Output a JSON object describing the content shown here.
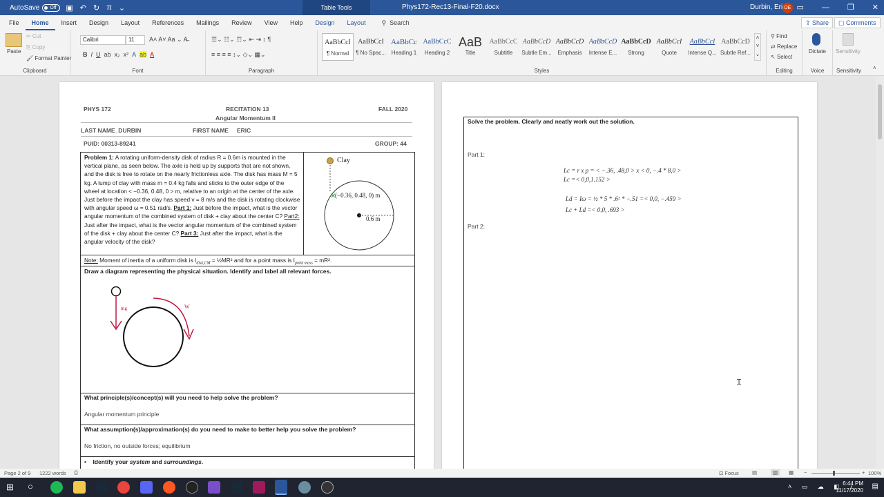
{
  "titlebar": {
    "autosave_label": "AutoSave",
    "autosave_state": "Off",
    "context_tab": "Table Tools",
    "doc_title": "Phys172-Rec13-Final-F20.docx",
    "user": "Durbin, Eric",
    "initials": "DE"
  },
  "menu": {
    "items": [
      "File",
      "Home",
      "Insert",
      "Design",
      "Layout",
      "References",
      "Mailings",
      "Review",
      "View",
      "Help",
      "Design",
      "Layout"
    ],
    "search": "Search",
    "share": "Share",
    "comments": "Comments"
  },
  "ribbon": {
    "clipboard": {
      "paste": "Paste",
      "cut": "Cut",
      "copy": "Copy",
      "format_painter": "Format Painter",
      "label": "Clipboard"
    },
    "font": {
      "family": "Calibri",
      "size": "11",
      "label": "Font"
    },
    "paragraph": {
      "label": "Paragraph"
    },
    "styles": {
      "items": [
        {
          "preview": "AaBbCcI",
          "name": "¶ Normal"
        },
        {
          "preview": "AaBbCcI",
          "name": "¶ No Spac..."
        },
        {
          "preview": "AaBbCc",
          "name": "Heading 1"
        },
        {
          "preview": "AaBbCcC",
          "name": "Heading 2"
        },
        {
          "preview": "AaB",
          "name": "Title"
        },
        {
          "preview": "AaBbCcC",
          "name": "Subtitle"
        },
        {
          "preview": "AaBbCcD",
          "name": "Subtle Em..."
        },
        {
          "preview": "AaBbCcD",
          "name": "Emphasis"
        },
        {
          "preview": "AaBbCcD",
          "name": "Intense E..."
        },
        {
          "preview": "AaBbCcD",
          "name": "Strong"
        },
        {
          "preview": "AaBbCcI",
          "name": "Quote"
        },
        {
          "preview": "AaBbCcI",
          "name": "Intense Q..."
        },
        {
          "preview": "AaBbCcD",
          "name": "Subtle Ref..."
        }
      ],
      "label": "Styles"
    },
    "editing": {
      "find": "Find",
      "replace": "Replace",
      "select": "Select",
      "label": "Editing"
    },
    "voice": {
      "dictate": "Dictate",
      "label": "Voice"
    },
    "sensitivity": {
      "btn": "Sensitivity",
      "label": "Sensitivity"
    }
  },
  "page1": {
    "course": "PHYS 172",
    "recitation": "RECITATION 13",
    "topic": "Angular Momentum II",
    "term": "FALL 2020",
    "last_name_label": "LAST NAME_DURBIN",
    "first_name_label": "FIRST NAME",
    "first_name": "ERIC",
    "puid": "PUID: 00313-89241",
    "group": "GROUP: 44",
    "problem_label": "Problem 1:",
    "problem_text": "A rotating uniform-density disk of radius R = 0.6m is mounted in the vertical plane, as seen below. The axle is held up by supports that are not shown, and the disk is free to rotate on the nearly frictionless axle. The disk has mass M = 5 kg. A lump of clay with mass m = 0.4 kg falls and sticks to the outer edge of the wheel at location < −0.36, 0.48, 0 > m, relative to an origin at the center of the axle. Just before the impact the clay has speed v = 8 m/s and the disk is rotating clockwise with angular speed ω = 0.51 rad/s.",
    "part1_label": "Part 1:",
    "part1_text": "Just before the impact, what is the vector angular momentum of the combined system of disk + clay about the center C?",
    "part2_label": "Part2:",
    "part2_text": "Just after the impact, what is the vector angular momentum of the combined system of the disk + clay about the center C?",
    "part3_label": "Part 3:",
    "part3_text": "Just after the impact, what is the angular velocity of the disk?",
    "clay_label": "Clay",
    "point_label": "(−0.36, 0.48, 0) m",
    "radius_label": "0.6 m",
    "note_label": "Note:",
    "note_text_a": "Moment of inertia of a uniform disk is I",
    "note_sub_a": "disk,CM",
    "note_text_b": "= ½MR² and for a point mass is I",
    "note_sub_b": "point mass",
    "note_text_c": "= mR².",
    "diagram_prompt": "Draw a diagram representing the physical situation. Identify and label all relevant forces.",
    "mg_label": "mg",
    "w_label": "W",
    "q1": "What principle(s)/concept(s) will you need to help solve the problem?",
    "a1": "Angular momentum principle",
    "q2": "What assumption(s)/approximation(s) do you need to make to better help you solve the problem?",
    "a2": "No friction, no outside forces; equilibrium",
    "bullet": "Identify your",
    "bullet_em1": "system",
    "bullet_and": "and",
    "bullet_em2": "surroundings",
    "bullet_end": "."
  },
  "page2": {
    "instruction": "Solve the problem. Clearly and neatly work out the solution.",
    "part1": "Part 1:",
    "eq1": "Lc = r x p = < −.36, .48,0 > x < 0, −.4 * 8,0 >",
    "eq2": "Lc =< 0,0,1.152 >",
    "eq3": "Ld = Iω = ½ * 5 * .6² * −.51 =< 0,0, −.459 >",
    "eq4": "Lc + Ld =< 0,0, .693 >",
    "part2": "Part 2:"
  },
  "statusbar": {
    "page": "Page 2 of 9",
    "words": "1222 words",
    "focus": "Focus",
    "zoom": "100%"
  },
  "tray": {
    "time": "6:44 PM",
    "date": "11/17/2020"
  }
}
